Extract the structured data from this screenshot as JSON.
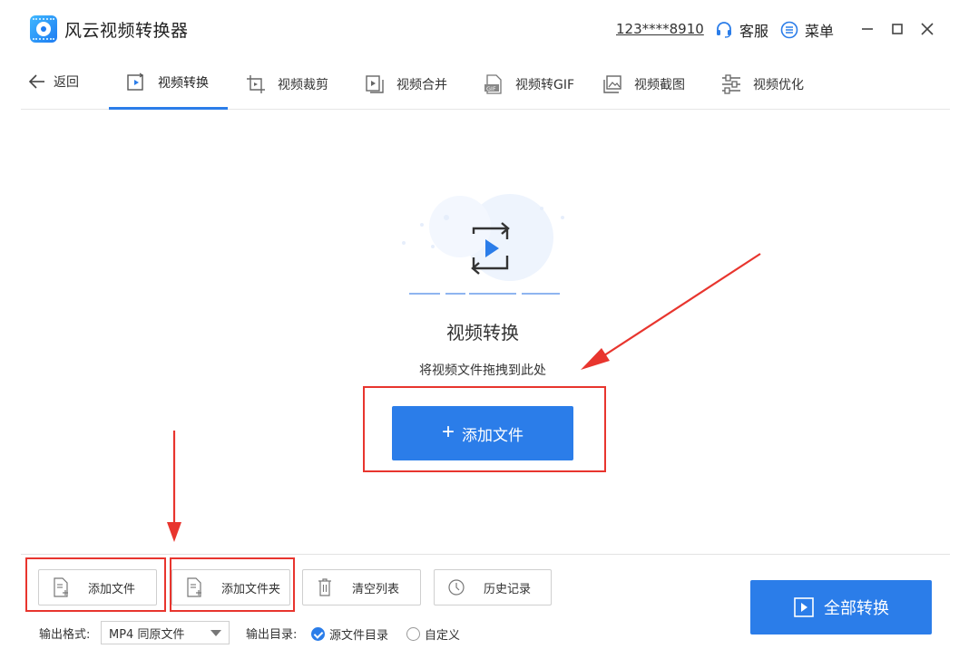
{
  "app": {
    "title": "风云视频转换器"
  },
  "header": {
    "account": "123****8910",
    "support_label": "客服",
    "menu_label": "菜单"
  },
  "nav": {
    "back_label": "返回",
    "tabs": [
      {
        "label": "视频转换",
        "active": true,
        "icon": "video-convert-icon"
      },
      {
        "label": "视频裁剪",
        "icon": "video-crop-icon"
      },
      {
        "label": "视频合并",
        "icon": "video-merge-icon"
      },
      {
        "label": "视频转GIF",
        "icon": "gif-icon"
      },
      {
        "label": "视频截图",
        "icon": "screenshot-icon"
      },
      {
        "label": "视频优化",
        "icon": "optimize-icon"
      }
    ]
  },
  "main": {
    "title": "视频转换",
    "hint": "将视频文件拖拽到此处",
    "add_file_button": "添加文件"
  },
  "toolbar": {
    "add_file": "添加文件",
    "add_folder": "添加文件夹",
    "clear_list": "清空列表",
    "history": "历史记录",
    "convert_all": "全部转换"
  },
  "output": {
    "format_label": "输出格式:",
    "format_value": "MP4 同原文件",
    "dir_label": "输出目录:",
    "dir_source": "源文件目录",
    "dir_custom": "自定义",
    "dir_selected": "源文件目录"
  },
  "colors": {
    "accent": "#2b7de9",
    "annotation": "#e8352e"
  }
}
